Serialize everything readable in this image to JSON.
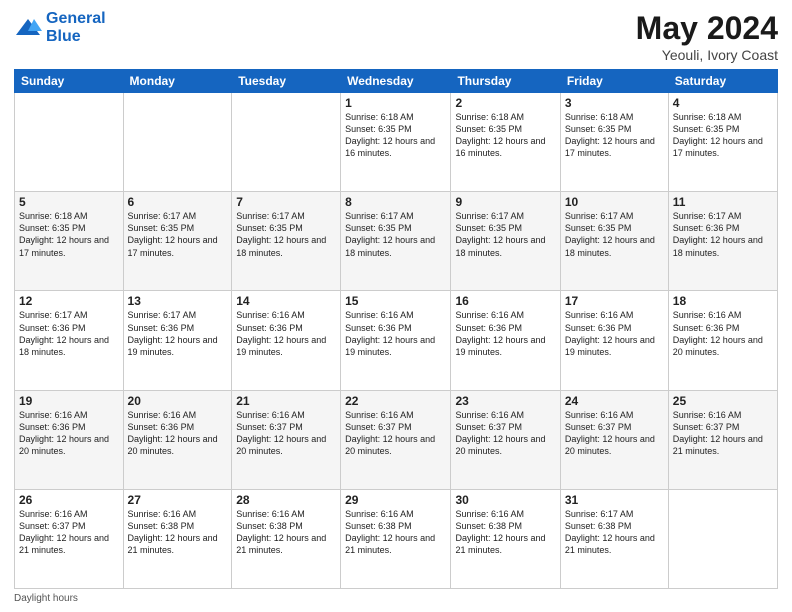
{
  "logo": {
    "line1": "General",
    "line2": "Blue"
  },
  "header": {
    "month": "May 2024",
    "location": "Yeouli, Ivory Coast"
  },
  "days_of_week": [
    "Sunday",
    "Monday",
    "Tuesday",
    "Wednesday",
    "Thursday",
    "Friday",
    "Saturday"
  ],
  "weeks": [
    [
      {
        "day": "",
        "info": ""
      },
      {
        "day": "",
        "info": ""
      },
      {
        "day": "",
        "info": ""
      },
      {
        "day": "1",
        "info": "Sunrise: 6:18 AM\nSunset: 6:35 PM\nDaylight: 12 hours\nand 16 minutes."
      },
      {
        "day": "2",
        "info": "Sunrise: 6:18 AM\nSunset: 6:35 PM\nDaylight: 12 hours\nand 16 minutes."
      },
      {
        "day": "3",
        "info": "Sunrise: 6:18 AM\nSunset: 6:35 PM\nDaylight: 12 hours\nand 17 minutes."
      },
      {
        "day": "4",
        "info": "Sunrise: 6:18 AM\nSunset: 6:35 PM\nDaylight: 12 hours\nand 17 minutes."
      }
    ],
    [
      {
        "day": "5",
        "info": "Sunrise: 6:18 AM\nSunset: 6:35 PM\nDaylight: 12 hours\nand 17 minutes."
      },
      {
        "day": "6",
        "info": "Sunrise: 6:17 AM\nSunset: 6:35 PM\nDaylight: 12 hours\nand 17 minutes."
      },
      {
        "day": "7",
        "info": "Sunrise: 6:17 AM\nSunset: 6:35 PM\nDaylight: 12 hours\nand 18 minutes."
      },
      {
        "day": "8",
        "info": "Sunrise: 6:17 AM\nSunset: 6:35 PM\nDaylight: 12 hours\nand 18 minutes."
      },
      {
        "day": "9",
        "info": "Sunrise: 6:17 AM\nSunset: 6:35 PM\nDaylight: 12 hours\nand 18 minutes."
      },
      {
        "day": "10",
        "info": "Sunrise: 6:17 AM\nSunset: 6:35 PM\nDaylight: 12 hours\nand 18 minutes."
      },
      {
        "day": "11",
        "info": "Sunrise: 6:17 AM\nSunset: 6:36 PM\nDaylight: 12 hours\nand 18 minutes."
      }
    ],
    [
      {
        "day": "12",
        "info": "Sunrise: 6:17 AM\nSunset: 6:36 PM\nDaylight: 12 hours\nand 18 minutes."
      },
      {
        "day": "13",
        "info": "Sunrise: 6:17 AM\nSunset: 6:36 PM\nDaylight: 12 hours\nand 19 minutes."
      },
      {
        "day": "14",
        "info": "Sunrise: 6:16 AM\nSunset: 6:36 PM\nDaylight: 12 hours\nand 19 minutes."
      },
      {
        "day": "15",
        "info": "Sunrise: 6:16 AM\nSunset: 6:36 PM\nDaylight: 12 hours\nand 19 minutes."
      },
      {
        "day": "16",
        "info": "Sunrise: 6:16 AM\nSunset: 6:36 PM\nDaylight: 12 hours\nand 19 minutes."
      },
      {
        "day": "17",
        "info": "Sunrise: 6:16 AM\nSunset: 6:36 PM\nDaylight: 12 hours\nand 19 minutes."
      },
      {
        "day": "18",
        "info": "Sunrise: 6:16 AM\nSunset: 6:36 PM\nDaylight: 12 hours\nand 20 minutes."
      }
    ],
    [
      {
        "day": "19",
        "info": "Sunrise: 6:16 AM\nSunset: 6:36 PM\nDaylight: 12 hours\nand 20 minutes."
      },
      {
        "day": "20",
        "info": "Sunrise: 6:16 AM\nSunset: 6:36 PM\nDaylight: 12 hours\nand 20 minutes."
      },
      {
        "day": "21",
        "info": "Sunrise: 6:16 AM\nSunset: 6:37 PM\nDaylight: 12 hours\nand 20 minutes."
      },
      {
        "day": "22",
        "info": "Sunrise: 6:16 AM\nSunset: 6:37 PM\nDaylight: 12 hours\nand 20 minutes."
      },
      {
        "day": "23",
        "info": "Sunrise: 6:16 AM\nSunset: 6:37 PM\nDaylight: 12 hours\nand 20 minutes."
      },
      {
        "day": "24",
        "info": "Sunrise: 6:16 AM\nSunset: 6:37 PM\nDaylight: 12 hours\nand 20 minutes."
      },
      {
        "day": "25",
        "info": "Sunrise: 6:16 AM\nSunset: 6:37 PM\nDaylight: 12 hours\nand 21 minutes."
      }
    ],
    [
      {
        "day": "26",
        "info": "Sunrise: 6:16 AM\nSunset: 6:37 PM\nDaylight: 12 hours\nand 21 minutes."
      },
      {
        "day": "27",
        "info": "Sunrise: 6:16 AM\nSunset: 6:38 PM\nDaylight: 12 hours\nand 21 minutes."
      },
      {
        "day": "28",
        "info": "Sunrise: 6:16 AM\nSunset: 6:38 PM\nDaylight: 12 hours\nand 21 minutes."
      },
      {
        "day": "29",
        "info": "Sunrise: 6:16 AM\nSunset: 6:38 PM\nDaylight: 12 hours\nand 21 minutes."
      },
      {
        "day": "30",
        "info": "Sunrise: 6:16 AM\nSunset: 6:38 PM\nDaylight: 12 hours\nand 21 minutes."
      },
      {
        "day": "31",
        "info": "Sunrise: 6:17 AM\nSunset: 6:38 PM\nDaylight: 12 hours\nand 21 minutes."
      },
      {
        "day": "",
        "info": ""
      }
    ]
  ],
  "footer": {
    "note": "Daylight hours"
  }
}
